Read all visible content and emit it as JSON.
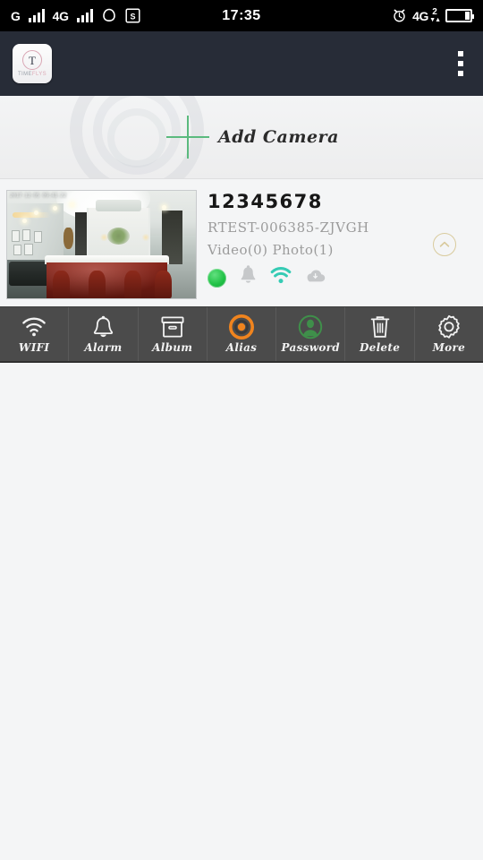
{
  "status_bar": {
    "carrier_g_label": "G",
    "network_label": "4G",
    "sim_icon": "cloud-signal-icon",
    "screenshot_icon": "s-badge-icon",
    "clock": "17:35",
    "alarm_icon": "alarm-clock-icon",
    "network_right_label": "4G",
    "network_right_sub": "2",
    "data_arrows": "▼▲",
    "battery_icon": "battery-icon"
  },
  "header": {
    "app_logo": {
      "letter": "T",
      "word_dark": "TIME",
      "word_pink": "FLYS",
      "icon": "timeflys-logo-icon"
    },
    "overflow_icon": "overflow-menu-icon"
  },
  "add_camera": {
    "label": "Add Camera",
    "plus_icon": "plus-icon"
  },
  "cameras": [
    {
      "name": "12345678",
      "uid": "RTEST-006385-ZJVGH",
      "counts": "Video(0)  Photo(1)",
      "video_count": 0,
      "photo_count": 1,
      "thumbnail_timestamp": "2017-12-05 09:41:22",
      "thumbnail_alt": "indoor-bar-lobby-camera-still",
      "status": {
        "online_icon": "online-status-dot",
        "online": true,
        "alarm_icon": "bell-icon",
        "alarm_enabled": false,
        "wifi_icon": "wifi-icon",
        "wifi_connected": true,
        "cloud_icon": "cloud-icon",
        "cloud_enabled": false
      },
      "collapse_icon": "chevron-up-icon",
      "expanded": true
    }
  ],
  "action_bar": [
    {
      "label": "WIFI",
      "icon": "wifi-icon"
    },
    {
      "label": "Alarm",
      "icon": "bell-icon"
    },
    {
      "label": "Album",
      "icon": "album-box-icon"
    },
    {
      "label": "Alias",
      "icon": "record-target-icon"
    },
    {
      "label": "Password",
      "icon": "user-circle-icon"
    },
    {
      "label": "Delete",
      "icon": "trash-icon"
    },
    {
      "label": "More",
      "icon": "gear-icon"
    }
  ],
  "colors": {
    "status_bar_bg": "#000000",
    "header_bg": "#272c37",
    "page_bg": "#f4f5f6",
    "accent_green": "#5bba7e",
    "online_green": "#22c247",
    "wifi_teal": "#35cbb4",
    "alias_orange": "#f0841e",
    "password_green": "#3f8f4a",
    "toolbar_bg": "#4b4b4b",
    "collapse_tan": "#d9cb9e",
    "muted_text": "#9b9b9b"
  }
}
